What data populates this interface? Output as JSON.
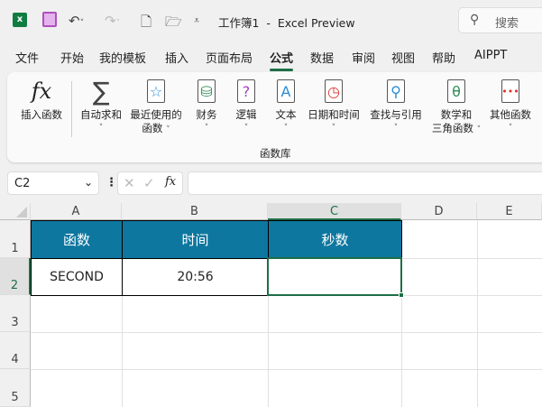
{
  "titlebar": {
    "title": "工作簿1  -  Excel Preview",
    "search_placeholder": "搜索"
  },
  "menu": [
    "文件",
    "开始",
    "我的模板",
    "插入",
    "页面布局",
    "公式",
    "数据",
    "审阅",
    "视图",
    "帮助",
    "AIPPT"
  ],
  "menu_active": "公式",
  "ribbon": {
    "insert_function": "插入函数",
    "buttons": [
      {
        "line1": "自动求和",
        "line2": ""
      },
      {
        "line1": "最近使用的",
        "line2": "函数"
      },
      {
        "line1": "财务",
        "line2": ""
      },
      {
        "line1": "逻辑",
        "line2": ""
      },
      {
        "line1": "文本",
        "line2": ""
      },
      {
        "line1": "日期和时间",
        "line2": ""
      },
      {
        "line1": "查找与引用",
        "line2": ""
      },
      {
        "line1": "数学和",
        "line2": "三角函数"
      },
      {
        "line1": "其他函数",
        "line2": ""
      }
    ],
    "group_label": "函数库"
  },
  "formula_bar": {
    "name_box": "C2",
    "formula": ""
  },
  "columns": [
    "A",
    "B",
    "C",
    "D",
    "E"
  ],
  "rows": [
    "1",
    "2",
    "3",
    "4",
    "5"
  ],
  "cells": {
    "A1": "函数",
    "B1": "时间",
    "C1": "秒数",
    "A2": "SECOND",
    "B2": "20:56",
    "C2": ""
  },
  "colors": {
    "header_fill": "#0e779f",
    "accent": "#1e6e45"
  }
}
